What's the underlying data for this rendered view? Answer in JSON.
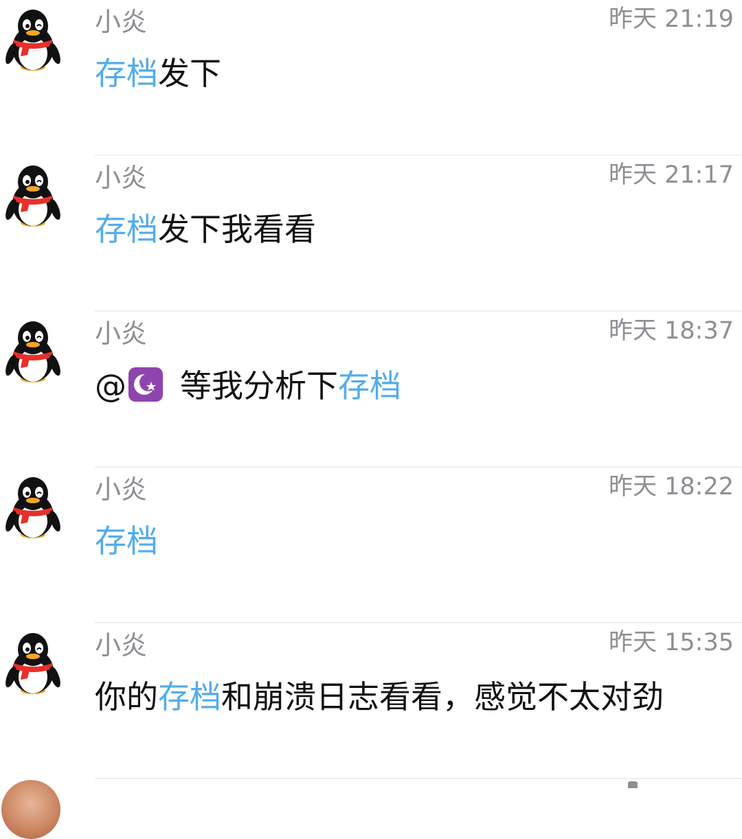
{
  "messages": [
    {
      "name": "小炎",
      "time": "昨天 21:19",
      "pre": "",
      "highlight": "存档",
      "post": "发下"
    },
    {
      "name": "小炎",
      "time": "昨天 21:17",
      "pre": "",
      "highlight": "存档",
      "post": "发下我看看"
    },
    {
      "name": "小炎",
      "time": "昨天 18:37",
      "mention_at": "@",
      "mention_icon": "crescent-star-icon",
      "pre": "等我分析下",
      "highlight": "存档",
      "post": ""
    },
    {
      "name": "小炎",
      "time": "昨天 18:22",
      "pre": "",
      "highlight": "存档",
      "post": ""
    },
    {
      "name": "小炎",
      "time": "昨天 15:35",
      "pre": "你的",
      "highlight": "存档",
      "post": "和崩溃日志看看，感觉不太对劲"
    }
  ],
  "colors": {
    "highlight": "#52acec",
    "meta_text": "#8e8e93",
    "body_text": "#111111",
    "divider": "#efefef",
    "emoji_bg": "#8e44ad"
  },
  "icons": {
    "avatar": "qq-penguin-icon"
  }
}
